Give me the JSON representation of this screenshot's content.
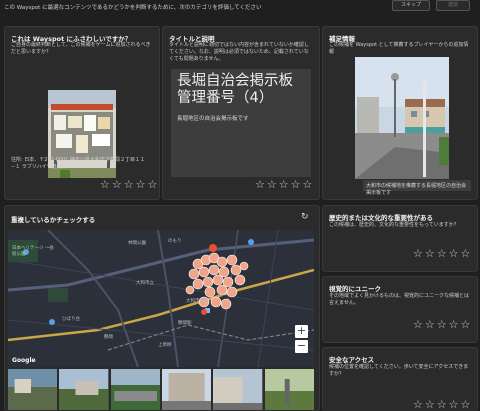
{
  "header": {
    "instruction": "この Wayspot に最適なコンテンツであるかどうかを判断するために、次のカテゴリを評価してください",
    "skip_label": "スキップ",
    "submit_label": "送信"
  },
  "card1": {
    "title": "これは Wayspot にふさわしいですか？",
    "subtitle": "ご自身の最終判断として、この候補をゲームに追加されるべきだと思いますか？",
    "address": "住所: 日本、〒242-0001 神奈川県大和市下鶴間２丁目１１−１ ラブリハイツ鶴間"
  },
  "card2": {
    "title": "タイトルと説明",
    "subtitle": "タイトルと説明に適切ではない内容が含まれていないか確認してください。なお、説明は必須ではないため、記載されていなくても問題ありません。",
    "wayspot_title": "長堀自治会掲示板 管理番号（4）",
    "wayspot_description": "長堀地区の自治会掲示板です"
  },
  "card3": {
    "title": "補足情報",
    "subtitle": "この候補を Wayspot として推薦するプレイヤーからの追加情報",
    "caption": "大和市の候補地を推薦する長堀地区の自治会掲示板です"
  },
  "location": {
    "title": "重複しているかチェックする",
    "map_labels": {
      "park": "日本ヘリテージ 〜長坂公園",
      "rinkan": "林間公園",
      "hibari": "ひばり台",
      "city": "大和市立",
      "nomori": "のもり",
      "fire": "大和市消防",
      "station": "鶴間駅",
      "tsuruma": "鶴間",
      "kamisoyagi": "上草柳",
      "google": "Google"
    },
    "zoom_in": "+",
    "zoom_out": "−"
  },
  "historical": {
    "title": "歴史的または文化的な重要性がある",
    "subtitle": "この候補は、歴史的、文化的な重要性をもっていますか？"
  },
  "visual": {
    "title": "視覚的にユニーク",
    "subtitle": "その地域でよく見かけるものは、視覚的にユニークな候補とは言えません。"
  },
  "safety": {
    "title": "安全なアクセス",
    "subtitle": "候補の位置を確認してください。歩いて安全にアクセスできますか？"
  },
  "star_glyph": "☆",
  "colors": {
    "background": "#1f1f1f",
    "card": "#2b2b2b",
    "pin": "#f0a58a",
    "selected_pin": "#e8502f"
  }
}
